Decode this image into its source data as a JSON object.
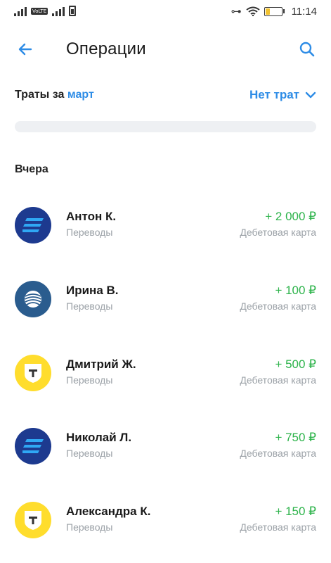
{
  "status_bar": {
    "volte": "VoLTE",
    "time": "11:14",
    "battery_level": 0.25,
    "icons": [
      "signal-icon",
      "volte-icon",
      "signal-icon",
      "sim-icon",
      "key-icon",
      "wifi-icon",
      "battery-icon"
    ]
  },
  "header": {
    "title": "Операции",
    "back_icon": "arrow-left-icon",
    "search_icon": "search-icon"
  },
  "spending": {
    "label": "Траты за",
    "month": "март",
    "no_spend": "Нет трат",
    "toggle_icon": "chevron-down-icon",
    "progress": 0
  },
  "section": {
    "title": "Вчера"
  },
  "operations": [
    {
      "name": "Антон К.",
      "category": "Переводы",
      "amount": "+ 2 000 ₽",
      "account": "Дебетовая карта",
      "bank": "vtb"
    },
    {
      "name": "Ирина В.",
      "category": "Переводы",
      "amount": "+ 100 ₽",
      "account": "Дебетовая карта",
      "bank": "gazprombank"
    },
    {
      "name": "Дмитрий Ж.",
      "category": "Переводы",
      "amount": "+ 500 ₽",
      "account": "Дебетовая карта",
      "bank": "tinkoff"
    },
    {
      "name": "Николай Л.",
      "category": "Переводы",
      "amount": "+ 750 ₽",
      "account": "Дебетовая карта",
      "bank": "vtb"
    },
    {
      "name": "Александра К.",
      "category": "Переводы",
      "amount": "+ 150 ₽",
      "account": "Дебетовая карта",
      "bank": "tinkoff"
    }
  ],
  "colors": {
    "accent": "#2d8ce6",
    "income": "#2cb34a",
    "muted": "#9aa0a6"
  }
}
